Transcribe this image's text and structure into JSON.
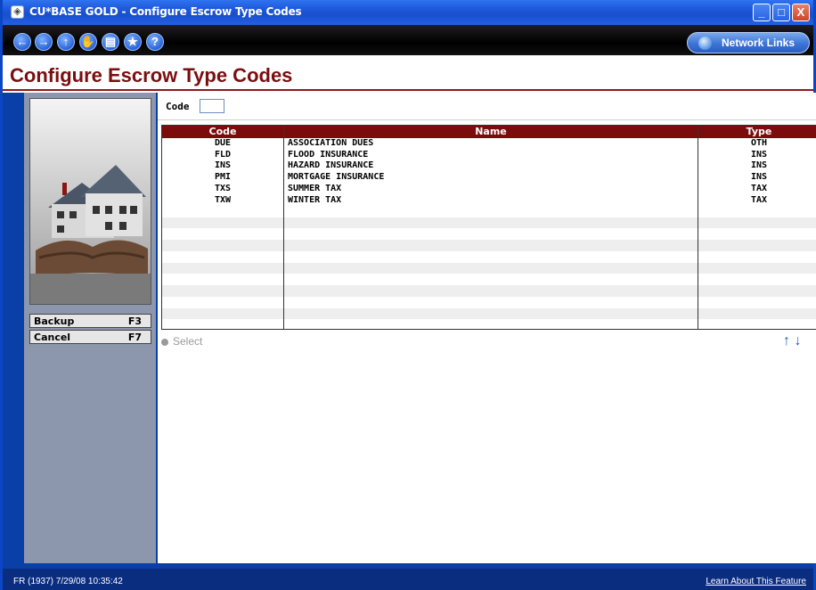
{
  "window": {
    "title": "CU*BASE GOLD - Configure Escrow Type Codes",
    "minimize": "_",
    "maximize": "□",
    "close": "X"
  },
  "toolbar": {
    "network_links": "Network Links"
  },
  "page": {
    "heading": "Configure Escrow Type Codes"
  },
  "form": {
    "code_label": "Code",
    "code_value": ""
  },
  "table": {
    "columns": [
      "Code",
      "Name",
      "Type"
    ],
    "rows": [
      {
        "code": "DUE",
        "name": "ASSOCIATION DUES",
        "type": "OTH"
      },
      {
        "code": "FLD",
        "name": "FLOOD INSURANCE",
        "type": "INS"
      },
      {
        "code": "INS",
        "name": "HAZARD INSURANCE",
        "type": "INS"
      },
      {
        "code": "PMI",
        "name": "MORTGAGE INSURANCE",
        "type": "INS"
      },
      {
        "code": "TXS",
        "name": "SUMMER TAX",
        "type": "TAX"
      },
      {
        "code": "TXW",
        "name": "WINTER TAX",
        "type": "TAX"
      }
    ]
  },
  "actions": {
    "select_label": "Select",
    "up_arrow": "↑",
    "down_arrow": "↓"
  },
  "fkeys": [
    {
      "label": "Backup",
      "key": "F3"
    },
    {
      "label": "Cancel",
      "key": "F7"
    }
  ],
  "status": {
    "left": "FR (1937) 7/29/08 10:35:42",
    "right": "Learn About This Feature"
  },
  "colors": {
    "heading": "#7a0e10",
    "table_header": "#7c0c0c",
    "left_panel": "#8c97ad",
    "frame": "#0a3fa8",
    "arrow": "#1e5ad6"
  }
}
